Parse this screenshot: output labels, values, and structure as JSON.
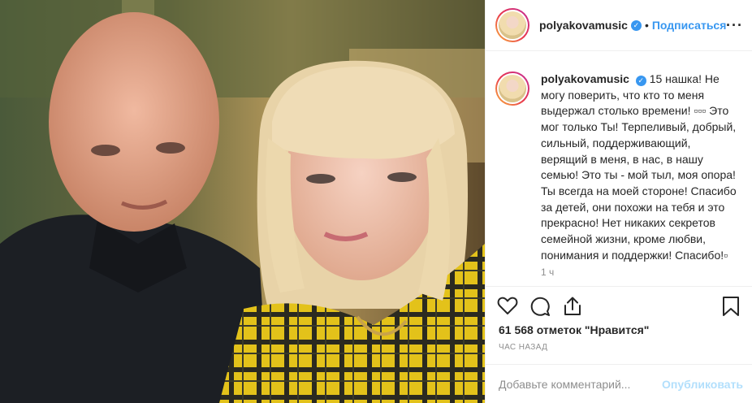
{
  "post": {
    "photo_alt_icon": "photo-couple"
  },
  "header": {
    "username": "polyakovamusic",
    "separator": "•",
    "follow_label": "Подписаться",
    "more_icon": "more-dots-icon"
  },
  "caption": {
    "username": "polyakovamusic",
    "text": "15 нашка! Не могу поверить, что кто то меня выдержал столько времени! ▫▫▫ Это мог только Ты! Терпеливый, добрый, сильный, поддерживающий, верящий в меня, в нас, в нашу семью! Это ты - мой тыл, моя опора! Ты всегда на моей стороне! Спасибо за детей, они похожи на тебя и это прекрасно! Нет никаких секретов семейной жизни, кроме любви, понимания и поддержки! Спасибо!▫",
    "time": "1 ч"
  },
  "actions": {
    "like_icon": "heart-icon",
    "comment_icon": "comment-icon",
    "share_icon": "share-icon",
    "save_icon": "bookmark-icon"
  },
  "likes": {
    "text": "61 568 отметок \"Нравится\""
  },
  "timestamp": {
    "text": "час назад"
  },
  "add_comment": {
    "placeholder": "Добавьте комментарий...",
    "publish_label": "Опубликовать"
  },
  "colors": {
    "link_blue": "#3897f0",
    "publish_disabled": "#b2dffc",
    "muted": "#8e8e8e",
    "text": "#262626"
  }
}
